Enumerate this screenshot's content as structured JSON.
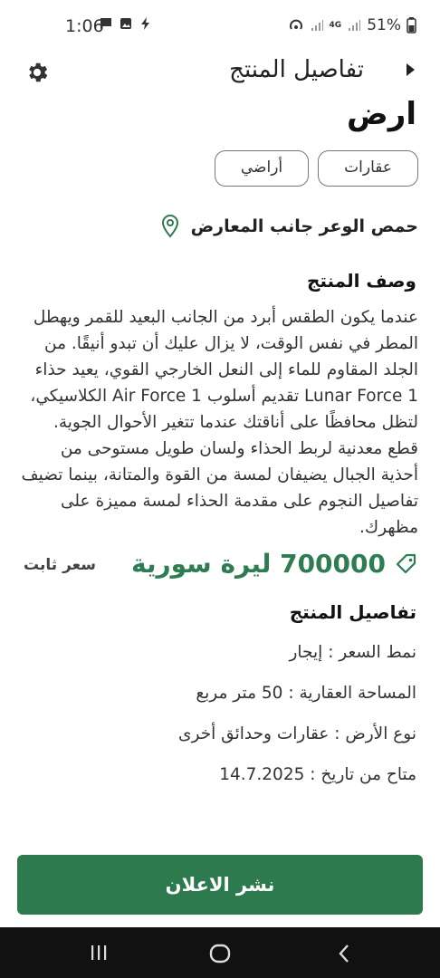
{
  "status_bar": {
    "time": "1:06",
    "network": "4G",
    "battery": "51%"
  },
  "header": {
    "title": "تفاصيل المنتج"
  },
  "product": {
    "title": "ارض",
    "categories": [
      "عقارات",
      "أراضي"
    ],
    "location": "حمص الوعر جانب المعارض",
    "description_heading": "وصف المنتج",
    "description": "عندما يكون الطقس أبرد من الجانب البعيد للقمر ويهطل المطر في نفس الوقت، لا يزال عليك أن تبدو أنيقًا. من الجلد المقاوم للماء إلى النعل الخارجي القوي، يعيد حذاء Lunar Force 1 تقديم أسلوب Air Force 1 الكلاسيكي، لتظل محافظًا على أناقتك عندما تتغير الأحوال الجوية. قطع معدنية لربط الحذاء ولسان طويل مستوحى من أحذية الجبال يضيفان لمسة من القوة والمتانة، بينما تضيف تفاصيل النجوم على مقدمة الحذاء لمسة مميزة على مظهرك.",
    "price": "700000 ليرة سورية",
    "price_type": "سعر ثابت",
    "details_heading": "تفاصيل المنتج",
    "details": [
      {
        "key": "نمط السعر :",
        "value": "إيجار"
      },
      {
        "key": "المساحة العقارية :",
        "value": "50 متر مربع"
      },
      {
        "key": "نوع الأرض :",
        "value": "عقارات وحدائق أخرى"
      },
      {
        "key": "متاح من تاريخ :",
        "value": "14.7.2025"
      }
    ]
  },
  "actions": {
    "publish_label": "نشر الاعلان"
  },
  "colors": {
    "accent": "#2d7a4f",
    "price": "#2e7d52"
  }
}
